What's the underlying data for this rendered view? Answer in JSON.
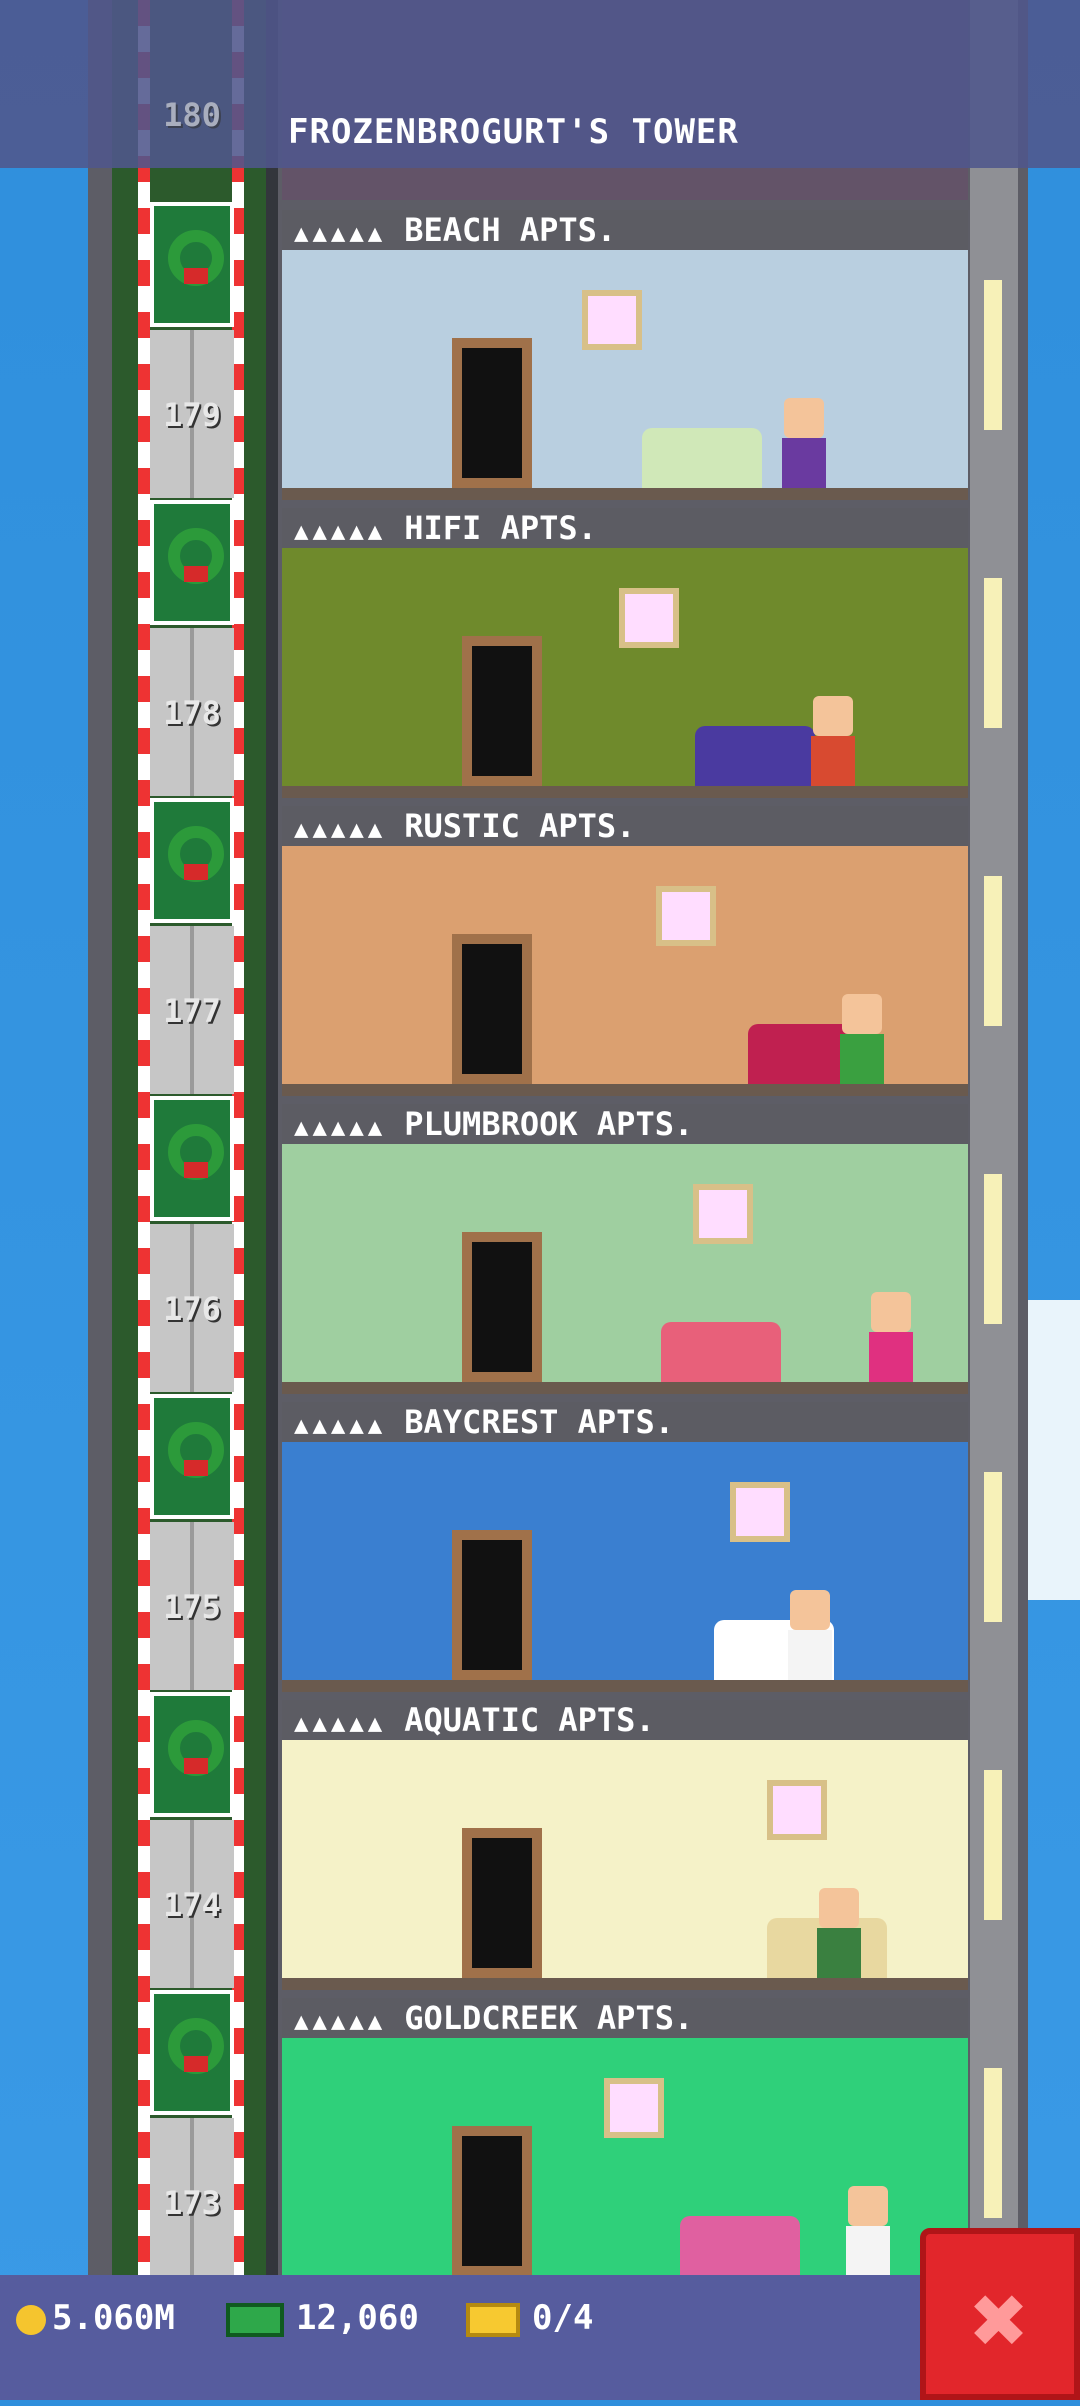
{
  "header": {
    "title": "FROZENBROGURT'S TOWER",
    "top_floor_number": "180"
  },
  "floors": [
    {
      "number": "179",
      "name": "BEACH APTS.",
      "stars": "▲▲▲▲▲",
      "wall": "#b9cfe0"
    },
    {
      "number": "178",
      "name": "HIFI APTS.",
      "stars": "▲▲▲▲▲",
      "wall": "#6f8a2c"
    },
    {
      "number": "177",
      "name": "RUSTIC APTS.",
      "stars": "▲▲▲▲▲",
      "wall": "#dba070"
    },
    {
      "number": "176",
      "name": "PLUMBROOK APTS.",
      "stars": "▲▲▲▲▲",
      "wall": "#9fcfa0"
    },
    {
      "number": "175",
      "name": "BAYCREST APTS.",
      "stars": "▲▲▲▲▲",
      "wall": "#3a7fd0"
    },
    {
      "number": "174",
      "name": "AQUATIC APTS.",
      "stars": "▲▲▲▲▲",
      "wall": "#f5f2c8"
    },
    {
      "number": "173",
      "name": "GOLDCREEK APTS.",
      "stars": "▲▲▲▲▲",
      "wall": "#2fd07a"
    }
  ],
  "status": {
    "coins": "5.060M",
    "bux": "12,060",
    "tickets": "0/4"
  },
  "close_button": {
    "icon": "close-icon",
    "label": "✖"
  }
}
